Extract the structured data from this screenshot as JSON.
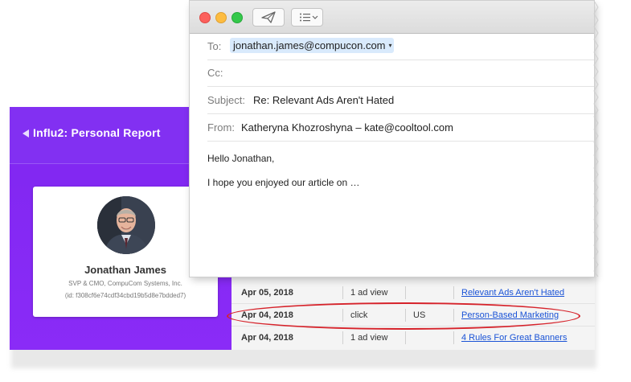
{
  "report": {
    "app_title": "Influ2: Personal Report",
    "person": {
      "name": "Jonathan James",
      "title": "SVP & CMO, CompuCom Systems, Inc.",
      "id": "(id: f308cf6e74cdf34cbd19b5d8e7bdded7)"
    },
    "rows": [
      {
        "date": "Apr 05, 2018",
        "action": "1 ad view",
        "country": "",
        "article": "Relevant Ads Aren't Hated"
      },
      {
        "date": "Apr 04, 2018",
        "action": "click",
        "country": "US",
        "article": "Person-Based Marketing"
      },
      {
        "date": "Apr 04, 2018",
        "action": "1 ad view",
        "country": "",
        "article": "4 Rules For Great Banners"
      }
    ],
    "highlight_color": "#d6232b",
    "accent_color": "#8230f2"
  },
  "mail": {
    "toolbar": {
      "send_icon": "paper-plane-icon",
      "format_icon": "list-icon"
    },
    "to_label": "To:",
    "to_value": "jonathan.james@compucon.com",
    "cc_label": "Cc:",
    "cc_value": "",
    "subject_label": "Subject:",
    "subject_value": "Re: Relevant Ads Aren't Hated",
    "from_label": "From:",
    "from_value": "Katheryna Khozroshyna – kate@cooltool.com",
    "body": {
      "greeting": "Hello Jonathan,",
      "line1": "I hope you enjoyed our article on …"
    }
  }
}
